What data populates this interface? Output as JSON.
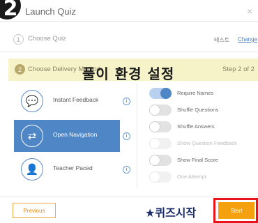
{
  "dialog": {
    "title": "Launch Quiz",
    "close_glyph": "×",
    "step_badge": "2"
  },
  "steps": [
    {
      "number": "1",
      "label": "Choose Quiz",
      "right_label": "테스트",
      "change_label": "Change"
    },
    {
      "number": "2",
      "label": "Choose Delivery Method",
      "count": "Step 2 of 2"
    }
  ],
  "overlay": {
    "title": "풀이 환경 설정",
    "start_annotation": "★퀴즈시작"
  },
  "delivery_modes": [
    {
      "label": "Instant Feedback",
      "icon": "feedback-icon",
      "glyph": "💬",
      "selected": false
    },
    {
      "label": "Open Navigation",
      "icon": "navigation-icon",
      "glyph": "⇄",
      "selected": true
    },
    {
      "label": "Teacher Paced",
      "icon": "teacher-icon",
      "glyph": "👤",
      "selected": false
    }
  ],
  "info_glyph": "i",
  "toggles": [
    {
      "label": "Require Names",
      "on": true,
      "disabled": false
    },
    {
      "label": "Shuffle Questions",
      "on": false,
      "disabled": false
    },
    {
      "label": "Shuffle Answers",
      "on": false,
      "disabled": false
    },
    {
      "label": "Show Question Feedback",
      "on": false,
      "disabled": true
    },
    {
      "label": "Show Final Score",
      "on": false,
      "disabled": false
    },
    {
      "label": "One Attempt",
      "on": false,
      "disabled": true
    }
  ],
  "footer": {
    "previous_label": "Previous",
    "start_label": "Start"
  },
  "colors": {
    "accent": "#4f86c6",
    "step_highlight": "#f7f3c9",
    "start_button": "#f5a10f",
    "start_highlight_border": "#e8141b",
    "annotation_text": "#1a2b6b"
  }
}
